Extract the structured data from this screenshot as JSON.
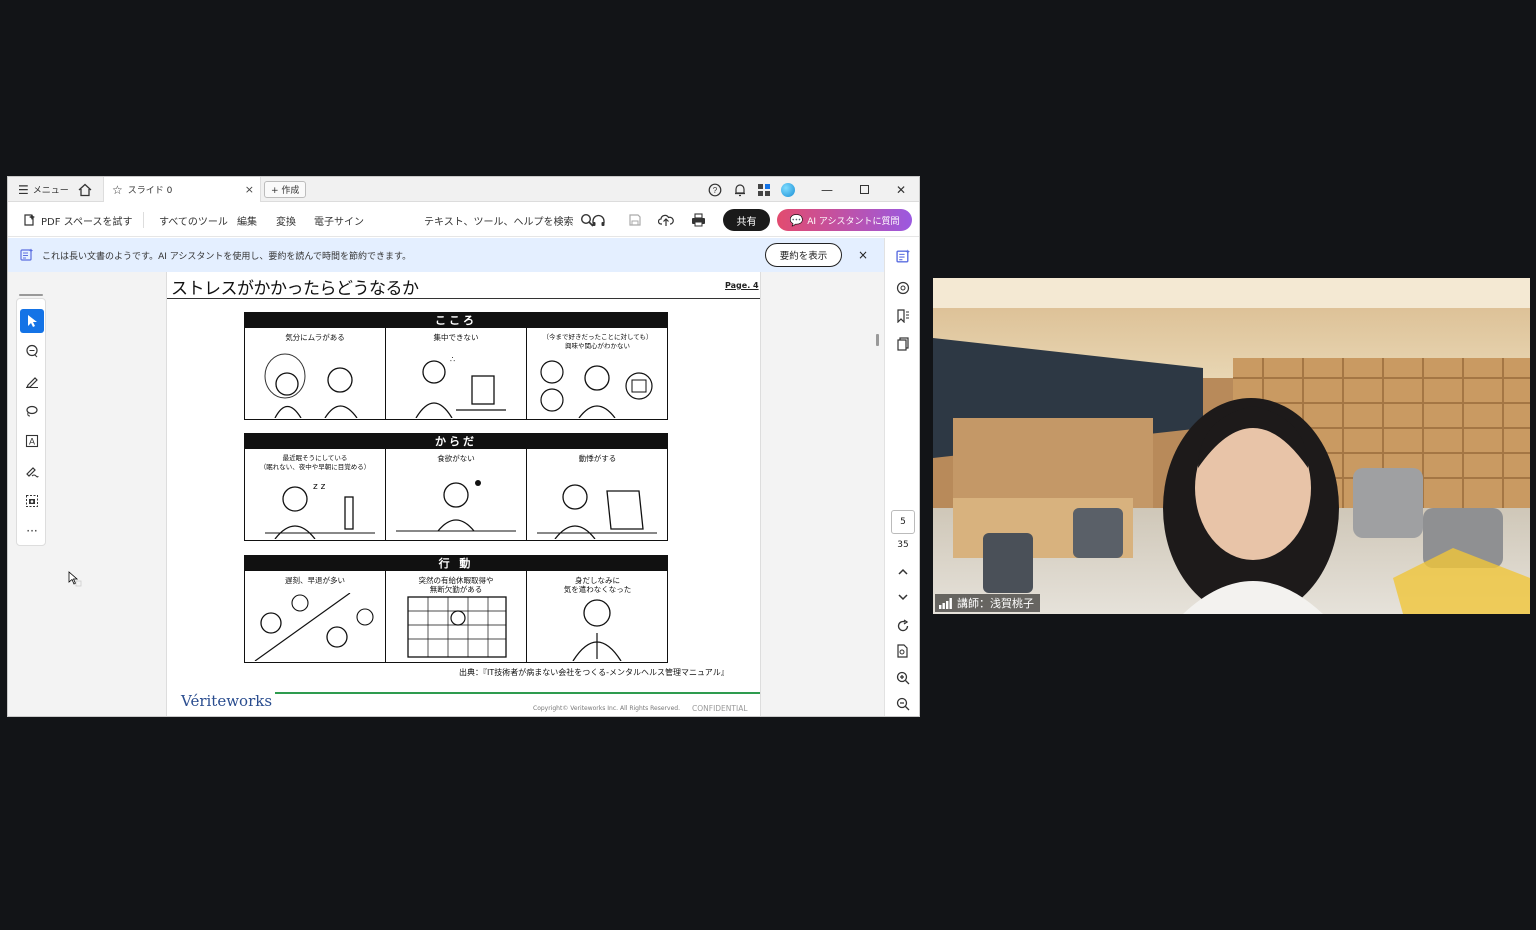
{
  "titlebar": {
    "menu_label": "メニュー",
    "tab_label": "スライド 0",
    "new_tab_label": "+ 作成"
  },
  "toolbar": {
    "try_pdf_space": "PDF スペースを試す",
    "all_tools": "すべてのツール",
    "edit": "編集",
    "convert": "変換",
    "esign": "電子サイン",
    "search": "テキスト、ツール、ヘルプを検索",
    "share": "共有",
    "ai_assistant": "AI アシスタントに質問"
  },
  "banner": {
    "message": "これは長い文書のようです。AI アシスタントを使用し、要約を読んで時間を節約できます。",
    "summary_button": "要約を表示",
    "close": "×"
  },
  "navigation": {
    "current_page": "5",
    "total_pages": "35"
  },
  "slide": {
    "title": "ストレスがかかったらどうなるか",
    "page_label": "Page. 4",
    "panels": [
      {
        "heading": "こころ",
        "cells": [
          {
            "caption": "気分にムラがある"
          },
          {
            "caption": "集中できない"
          },
          {
            "caption": "（今まで好きだったことに対しても）\n興味や関心がわかない"
          }
        ]
      },
      {
        "heading": "からだ",
        "cells": [
          {
            "caption": "最近眠そうにしている\n（眠れない、夜中や早朝に目覚める）"
          },
          {
            "caption": "食欲がない"
          },
          {
            "caption": "動悸がする"
          }
        ]
      },
      {
        "heading": "行 動",
        "cells": [
          {
            "caption": "遅刻、早退が多い"
          },
          {
            "caption": "突然の有給休暇取得や\n無断欠勤がある"
          },
          {
            "caption": "身だしなみに\n気を遣わなくなった"
          }
        ]
      }
    ],
    "source": "出典：『IT技術者が病まない会社をつくる-メンタルヘルス管理マニュアル』",
    "logo": "Vériteworks",
    "copyright": "Copyright© Veriteworks Inc.  All Rights Reserved.",
    "confidential": "CONFIDENTIAL"
  },
  "video": {
    "speaker_name": "講師：浅賀桃子"
  },
  "colors": {
    "accent_blue": "#1473e6",
    "share_button": "#1a1a1a",
    "ai_gradient_start": "#e24b6f",
    "ai_gradient_end": "#9b59e0",
    "banner_bg": "#e4efff",
    "logo_green_rule": "#2e9c4f",
    "desktop_bg": "#121417"
  }
}
